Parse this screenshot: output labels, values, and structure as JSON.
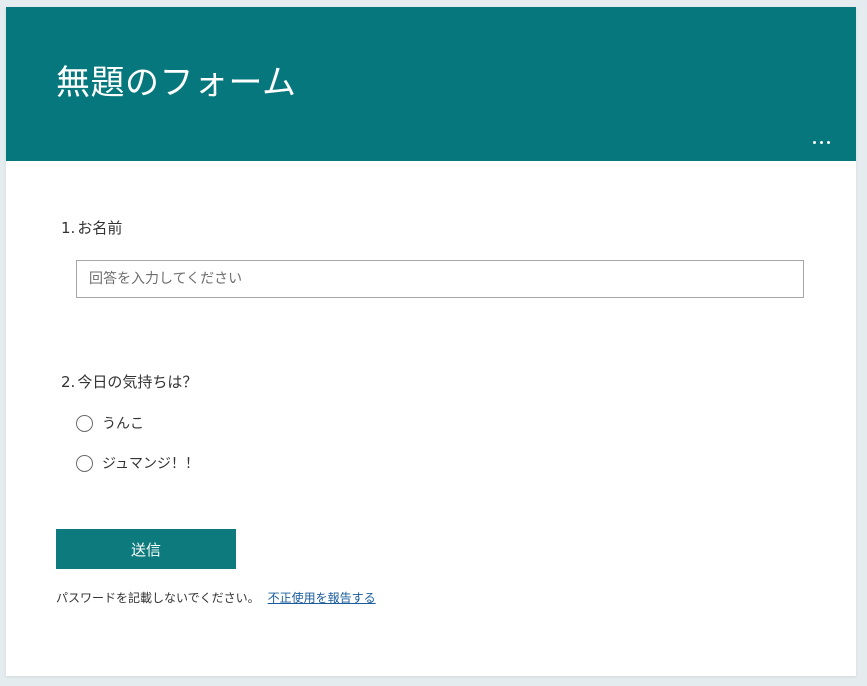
{
  "form": {
    "title": "無題のフォーム",
    "header_color": "#06777c",
    "more_options_icon": "ellipsis-icon"
  },
  "questions": [
    {
      "number": "1.",
      "title": "お名前",
      "type": "text",
      "placeholder": "回答を入力してください",
      "value": ""
    },
    {
      "number": "2.",
      "title": "今日の気持ちは？",
      "type": "radio",
      "options": [
        "うんこ",
        "ジュマンジ！！"
      ]
    }
  ],
  "submit": {
    "label": "送信",
    "color": "#0d7a7d"
  },
  "footer": {
    "notice": "パスワードを記載しないでください。",
    "report_link": "不正使用を報告する"
  }
}
